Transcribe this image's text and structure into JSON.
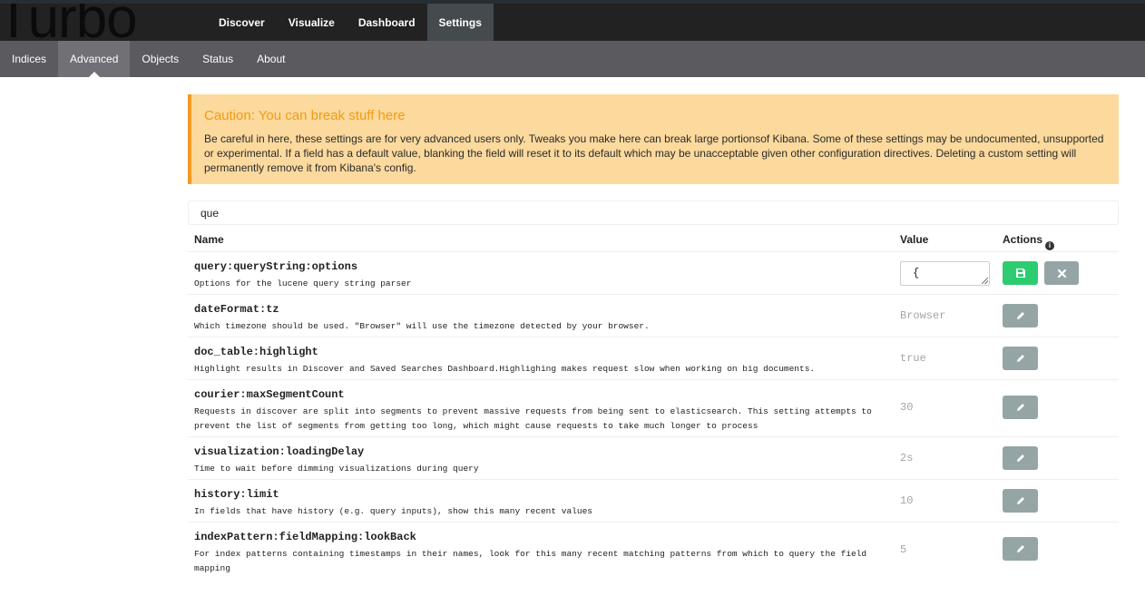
{
  "app": {
    "logo_text": "Turbo"
  },
  "top_nav": {
    "tabs": [
      "Discover",
      "Visualize",
      "Dashboard",
      "Settings"
    ],
    "active": "Settings"
  },
  "sub_nav": {
    "tabs": [
      "Indices",
      "Advanced",
      "Objects",
      "Status",
      "About"
    ],
    "active": "Advanced"
  },
  "caution": {
    "title": "Caution: You can break stuff here",
    "body": "Be careful in here, these settings are for very advanced users only. Tweaks you make here can break large portionsof Kibana. Some of these settings may be undocumented, unsupported or experimental. If a field has a default value, blanking the field will reset it to its default which may be unacceptable given other configuration directives. Deleting a custom setting will permanently remove it from Kibana's config."
  },
  "search": {
    "value": "que"
  },
  "table": {
    "headers": {
      "name": "Name",
      "value": "Value",
      "actions": "Actions"
    },
    "rows": [
      {
        "name": "query:queryString:options",
        "description": "Options for the lucene query string parser",
        "value": "{",
        "editing": true
      },
      {
        "name": "dateFormat:tz",
        "description": "Which timezone should be used. \"Browser\" will use the timezone detected by your browser.",
        "value": "Browser"
      },
      {
        "name": "doc_table:highlight",
        "description": "Highlight results in Discover and Saved Searches Dashboard.Highlighing makes request slow when working on big documents.",
        "value": "true"
      },
      {
        "name": "courier:maxSegmentCount",
        "description": "Requests in discover are split into segments to prevent massive requests from being sent to elasticsearch. This setting attempts to prevent the list of segments from getting too long, which might cause requests to take much longer to process",
        "value": "30"
      },
      {
        "name": "visualization:loadingDelay",
        "description": "Time to wait before dimming visualizations during query",
        "value": "2s"
      },
      {
        "name": "history:limit",
        "description": "In fields that have history (e.g. query inputs), show this many recent values",
        "value": "10"
      },
      {
        "name": "indexPattern:fieldMapping:lookBack",
        "description": "For index patterns containing timestamps in their names, look for this many recent matching patterns from which to query the field mapping",
        "value": "5"
      }
    ]
  },
  "icons": {
    "save": "save-icon",
    "cancel": "close-icon",
    "edit": "pencil-icon",
    "info": "info-icon"
  },
  "colors": {
    "save_button": "#2ecc71",
    "action_button": "#95a5a6",
    "caution_bg": "#fcd99d",
    "caution_title": "#f39c12"
  }
}
